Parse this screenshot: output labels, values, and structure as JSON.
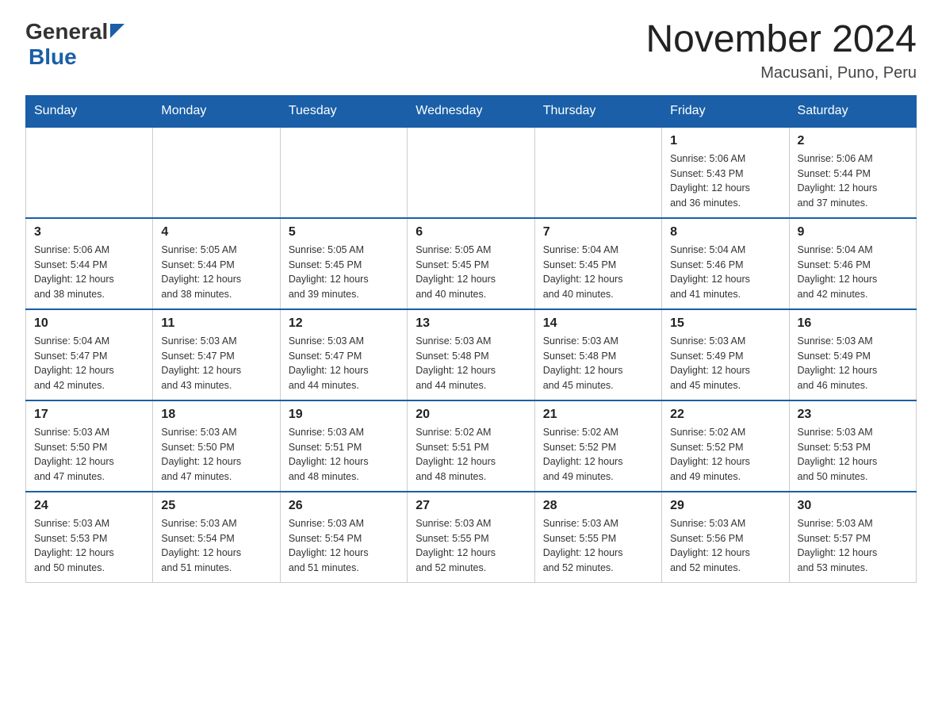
{
  "header": {
    "logo_general": "General",
    "logo_blue": "Blue",
    "month_title": "November 2024",
    "location": "Macusani, Puno, Peru"
  },
  "weekdays": [
    "Sunday",
    "Monday",
    "Tuesday",
    "Wednesday",
    "Thursday",
    "Friday",
    "Saturday"
  ],
  "weeks": [
    [
      {
        "day": "",
        "info": ""
      },
      {
        "day": "",
        "info": ""
      },
      {
        "day": "",
        "info": ""
      },
      {
        "day": "",
        "info": ""
      },
      {
        "day": "",
        "info": ""
      },
      {
        "day": "1",
        "info": "Sunrise: 5:06 AM\nSunset: 5:43 PM\nDaylight: 12 hours\nand 36 minutes."
      },
      {
        "day": "2",
        "info": "Sunrise: 5:06 AM\nSunset: 5:44 PM\nDaylight: 12 hours\nand 37 minutes."
      }
    ],
    [
      {
        "day": "3",
        "info": "Sunrise: 5:06 AM\nSunset: 5:44 PM\nDaylight: 12 hours\nand 38 minutes."
      },
      {
        "day": "4",
        "info": "Sunrise: 5:05 AM\nSunset: 5:44 PM\nDaylight: 12 hours\nand 38 minutes."
      },
      {
        "day": "5",
        "info": "Sunrise: 5:05 AM\nSunset: 5:45 PM\nDaylight: 12 hours\nand 39 minutes."
      },
      {
        "day": "6",
        "info": "Sunrise: 5:05 AM\nSunset: 5:45 PM\nDaylight: 12 hours\nand 40 minutes."
      },
      {
        "day": "7",
        "info": "Sunrise: 5:04 AM\nSunset: 5:45 PM\nDaylight: 12 hours\nand 40 minutes."
      },
      {
        "day": "8",
        "info": "Sunrise: 5:04 AM\nSunset: 5:46 PM\nDaylight: 12 hours\nand 41 minutes."
      },
      {
        "day": "9",
        "info": "Sunrise: 5:04 AM\nSunset: 5:46 PM\nDaylight: 12 hours\nand 42 minutes."
      }
    ],
    [
      {
        "day": "10",
        "info": "Sunrise: 5:04 AM\nSunset: 5:47 PM\nDaylight: 12 hours\nand 42 minutes."
      },
      {
        "day": "11",
        "info": "Sunrise: 5:03 AM\nSunset: 5:47 PM\nDaylight: 12 hours\nand 43 minutes."
      },
      {
        "day": "12",
        "info": "Sunrise: 5:03 AM\nSunset: 5:47 PM\nDaylight: 12 hours\nand 44 minutes."
      },
      {
        "day": "13",
        "info": "Sunrise: 5:03 AM\nSunset: 5:48 PM\nDaylight: 12 hours\nand 44 minutes."
      },
      {
        "day": "14",
        "info": "Sunrise: 5:03 AM\nSunset: 5:48 PM\nDaylight: 12 hours\nand 45 minutes."
      },
      {
        "day": "15",
        "info": "Sunrise: 5:03 AM\nSunset: 5:49 PM\nDaylight: 12 hours\nand 45 minutes."
      },
      {
        "day": "16",
        "info": "Sunrise: 5:03 AM\nSunset: 5:49 PM\nDaylight: 12 hours\nand 46 minutes."
      }
    ],
    [
      {
        "day": "17",
        "info": "Sunrise: 5:03 AM\nSunset: 5:50 PM\nDaylight: 12 hours\nand 47 minutes."
      },
      {
        "day": "18",
        "info": "Sunrise: 5:03 AM\nSunset: 5:50 PM\nDaylight: 12 hours\nand 47 minutes."
      },
      {
        "day": "19",
        "info": "Sunrise: 5:03 AM\nSunset: 5:51 PM\nDaylight: 12 hours\nand 48 minutes."
      },
      {
        "day": "20",
        "info": "Sunrise: 5:02 AM\nSunset: 5:51 PM\nDaylight: 12 hours\nand 48 minutes."
      },
      {
        "day": "21",
        "info": "Sunrise: 5:02 AM\nSunset: 5:52 PM\nDaylight: 12 hours\nand 49 minutes."
      },
      {
        "day": "22",
        "info": "Sunrise: 5:02 AM\nSunset: 5:52 PM\nDaylight: 12 hours\nand 49 minutes."
      },
      {
        "day": "23",
        "info": "Sunrise: 5:03 AM\nSunset: 5:53 PM\nDaylight: 12 hours\nand 50 minutes."
      }
    ],
    [
      {
        "day": "24",
        "info": "Sunrise: 5:03 AM\nSunset: 5:53 PM\nDaylight: 12 hours\nand 50 minutes."
      },
      {
        "day": "25",
        "info": "Sunrise: 5:03 AM\nSunset: 5:54 PM\nDaylight: 12 hours\nand 51 minutes."
      },
      {
        "day": "26",
        "info": "Sunrise: 5:03 AM\nSunset: 5:54 PM\nDaylight: 12 hours\nand 51 minutes."
      },
      {
        "day": "27",
        "info": "Sunrise: 5:03 AM\nSunset: 5:55 PM\nDaylight: 12 hours\nand 52 minutes."
      },
      {
        "day": "28",
        "info": "Sunrise: 5:03 AM\nSunset: 5:55 PM\nDaylight: 12 hours\nand 52 minutes."
      },
      {
        "day": "29",
        "info": "Sunrise: 5:03 AM\nSunset: 5:56 PM\nDaylight: 12 hours\nand 52 minutes."
      },
      {
        "day": "30",
        "info": "Sunrise: 5:03 AM\nSunset: 5:57 PM\nDaylight: 12 hours\nand 53 minutes."
      }
    ]
  ]
}
